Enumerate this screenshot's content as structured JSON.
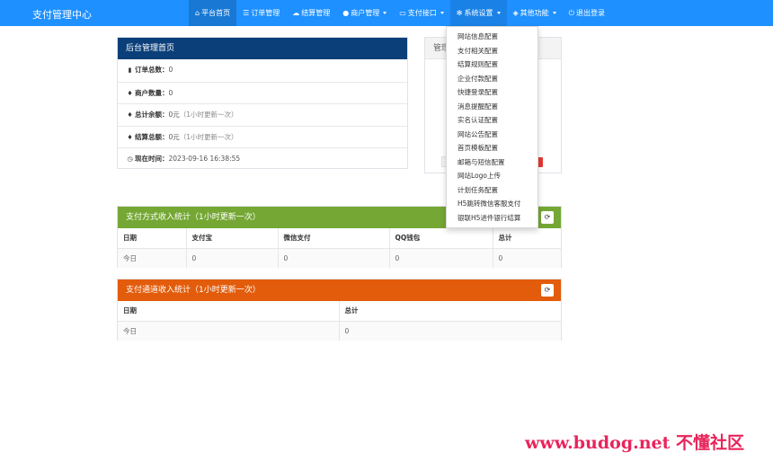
{
  "brand": "支付管理中心",
  "nav": [
    {
      "icon": "home-icon",
      "glyph": "⌂",
      "label": "平台首页",
      "caret": false
    },
    {
      "icon": "list-icon",
      "glyph": "☰",
      "label": "订单管理",
      "caret": false
    },
    {
      "icon": "cloud-icon",
      "glyph": "☁",
      "label": "结算管理",
      "caret": false
    },
    {
      "icon": "user-icon",
      "glyph": "●",
      "label": "商户管理",
      "caret": true
    },
    {
      "icon": "credit-card-icon",
      "glyph": "▭",
      "label": "支付接口",
      "caret": true
    },
    {
      "icon": "gear-icon",
      "glyph": "✻",
      "label": "系统设置",
      "caret": true
    },
    {
      "icon": "cube-icon",
      "glyph": "◈",
      "label": "其他功能",
      "caret": true
    },
    {
      "icon": "power-icon",
      "glyph": "⏻",
      "label": "退出登录",
      "caret": false
    }
  ],
  "admin_panel": {
    "title": "后台管理首页",
    "rows": [
      {
        "icon": "bar-chart-icon",
        "glyph": "▮",
        "label": "订单总数：",
        "value": "0",
        "note": ""
      },
      {
        "icon": "tint-icon",
        "glyph": "♦",
        "label": "商户数量：",
        "value": "0",
        "note": ""
      },
      {
        "icon": "tint-icon",
        "glyph": "♦",
        "label": "总计余额：",
        "value": "0元",
        "note": "（1小时更新一次）"
      },
      {
        "icon": "tint-icon",
        "glyph": "♦",
        "label": "结算总额：",
        "value": "0元",
        "note": "（1小时更新一次）"
      },
      {
        "icon": "clock-icon",
        "glyph": "◷",
        "label": "现在时间：",
        "value": "2023-09-16 16:38:55",
        "note": ""
      }
    ]
  },
  "manager_panel": {
    "title": "管理"
  },
  "pay_method_panel": {
    "title": "支付方式收入统计（1小时更新一次）",
    "headers": [
      "日期",
      "支付宝",
      "微信支付",
      "QQ钱包",
      "总计"
    ],
    "row": [
      "今日",
      "0",
      "0",
      "0",
      "0"
    ]
  },
  "pay_channel_panel": {
    "title": "支付通道收入统计（1小时更新一次）",
    "headers": [
      "日期",
      "总计"
    ],
    "row": [
      "今日",
      "0"
    ]
  },
  "settings_menu": [
    "网站信息配置",
    "支付相关配置",
    "结算规则配置",
    "企业付款配置",
    "快捷登录配置",
    "消息提醒配置",
    "实名认证配置",
    "网站公告配置",
    "首页模板配置",
    "邮箱与短信配置",
    "网站Logo上传",
    "计划任务配置",
    "H5跳转微信客服支付",
    "银联H5进件银行结算"
  ],
  "watermark": "www.budog.net 不懂社区",
  "colors": {
    "navbar": "#1e90ff",
    "panel_blue": "#0b3f7a",
    "panel_green": "#74a733",
    "panel_orange": "#e25c0b"
  }
}
